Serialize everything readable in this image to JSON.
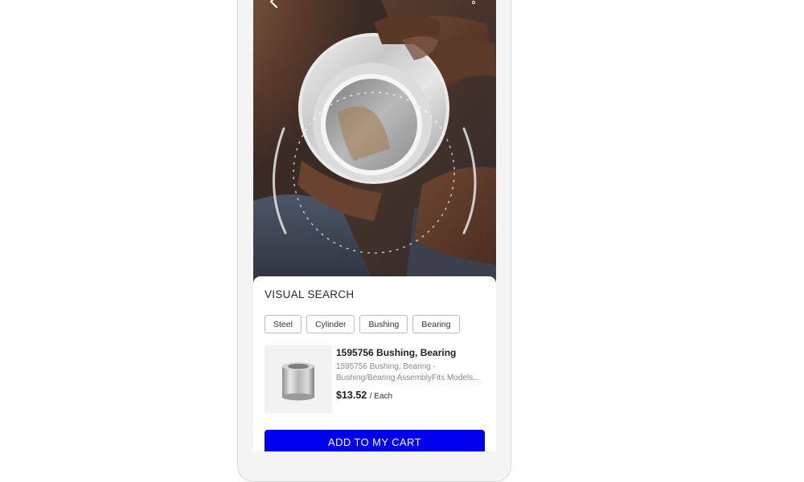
{
  "visual_search": {
    "title": "VISUAL SEARCH",
    "tags": [
      {
        "label": "Steel"
      },
      {
        "label": "Cylinder"
      },
      {
        "label": "Bushing"
      },
      {
        "label": "Bearing"
      }
    ]
  },
  "product": {
    "name": "1595756 Bushing, Bearing",
    "description_line1": "1595756 Bushing, Bearing -",
    "description_line2": "Bushing/Bearing AssemblyFits Models...",
    "price": "$13.52",
    "unit": "/ Each",
    "thumbnail_icon": "bushing-product-image"
  },
  "cart": {
    "button_label": "ADD TO MY CART"
  },
  "colors": {
    "accent": "#0000ef",
    "tag_border": "#bdbdbd",
    "muted_text": "#8a8a8a"
  },
  "icons": {
    "back": "chevron-left-icon",
    "more": "more-vertical-icon"
  }
}
